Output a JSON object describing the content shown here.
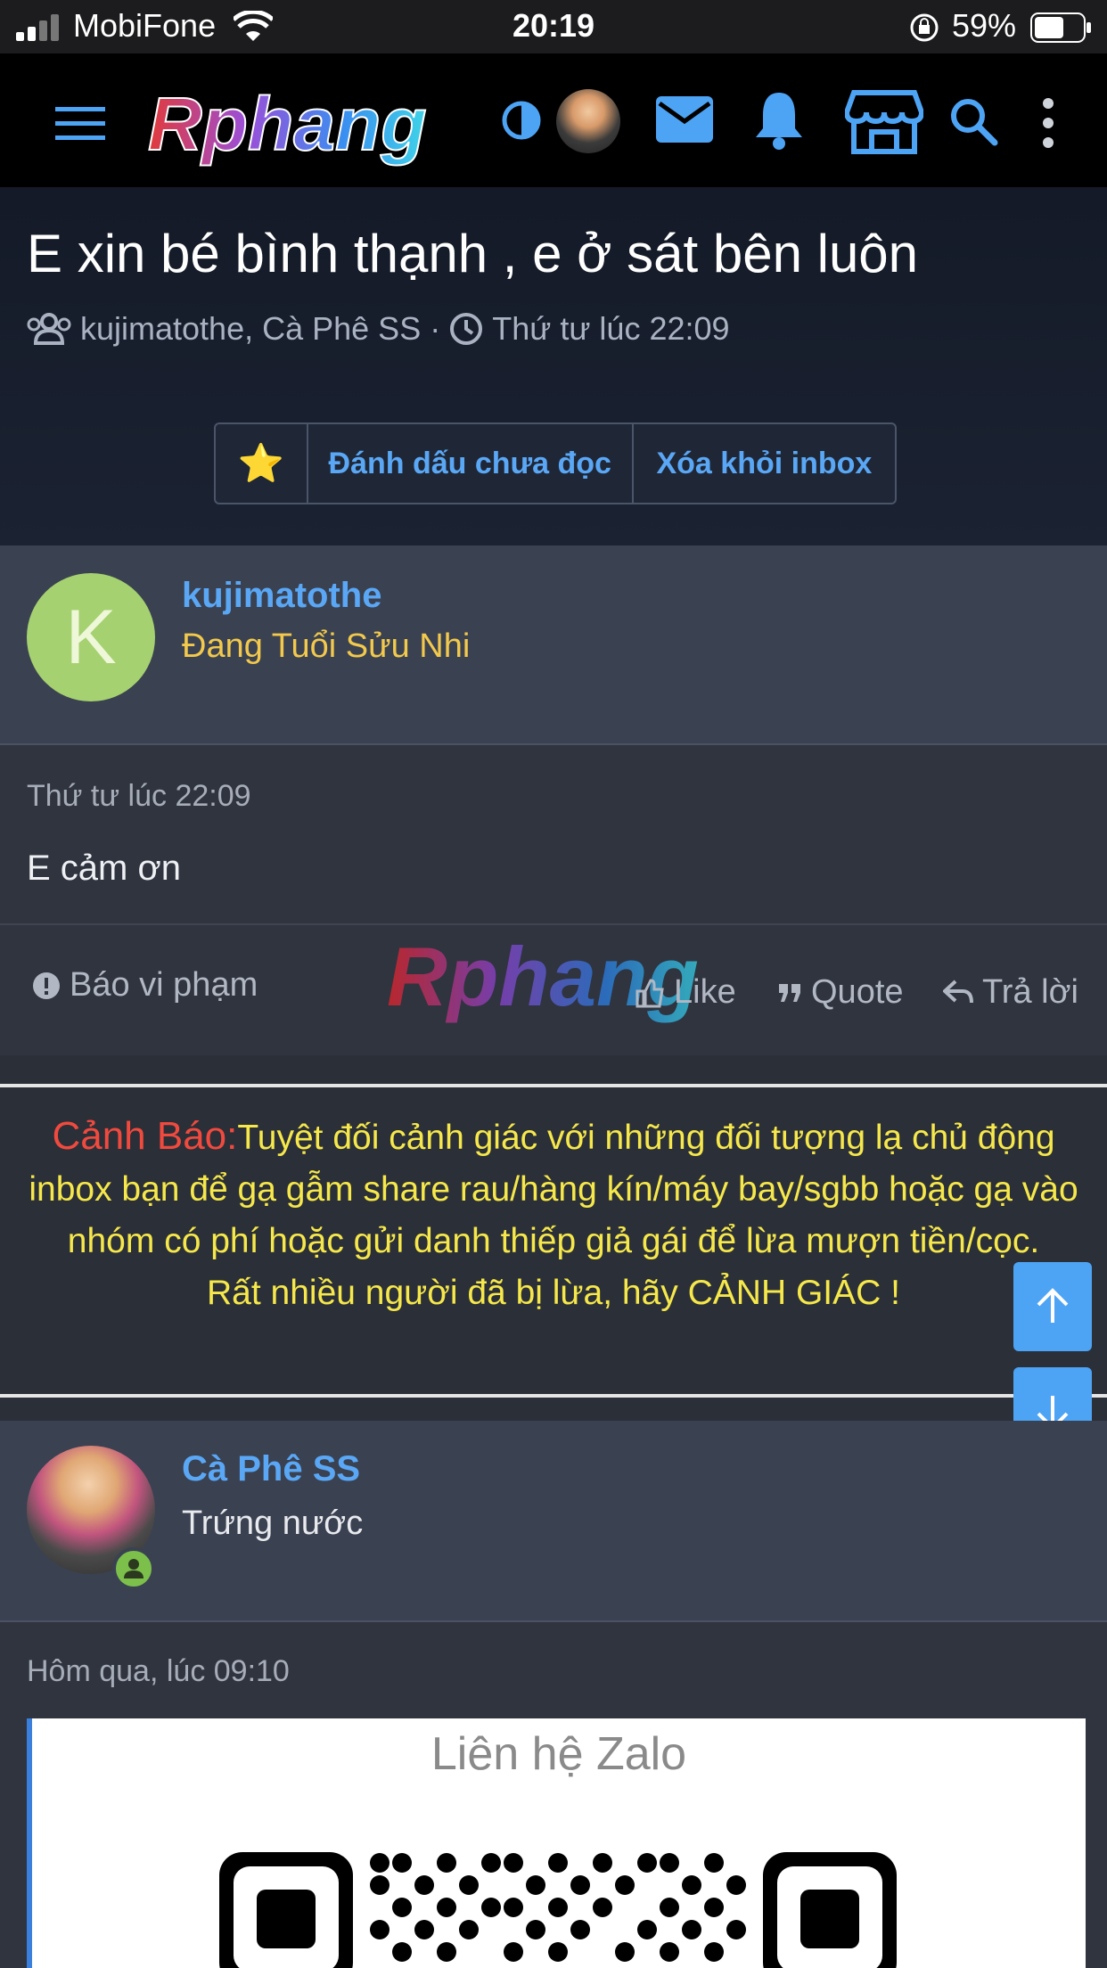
{
  "status_bar": {
    "carrier": "MobiFone",
    "time": "20:19",
    "battery": "59%"
  },
  "nav": {
    "logo": "Rphang",
    "icons": [
      "menu-icon",
      "contrast-icon",
      "avatar",
      "mail-icon",
      "bell-icon",
      "store-icon",
      "search-icon",
      "more-vertical-icon"
    ]
  },
  "thread": {
    "title": "E xin bé bình thạnh , e ở sát bên luôn",
    "participants": "kujimatothe, Cà Phê SS",
    "separator": "·",
    "date": "Thứ tư lúc 22:09",
    "buttons": {
      "star": "⭐",
      "mark_unread": "Đánh dấu chưa đọc",
      "remove_inbox": "Xóa khỏi inbox"
    }
  },
  "post1": {
    "avatar_letter": "K",
    "username": "kujimatothe",
    "user_title": "Đang Tuổi Sửu Nhi",
    "date": "Thứ tư lúc 22:09",
    "content": "E cảm ơn",
    "actions": {
      "report": "Báo vi phạm",
      "like": "Like",
      "quote": "Quote",
      "reply": "Trả lời"
    },
    "watermark": "Rphang"
  },
  "warning": {
    "label": "Cảnh Báo:",
    "text": "Tuyệt đối cảnh giác với những đối tượng lạ chủ động inbox bạn để gạ gẫm share rau/hàng kín/máy bay/sgbb hoặc gạ vào nhóm có phí hoặc gửi danh thiếp giả gái để lừa mượn tiền/cọc.",
    "text2": "Rất nhiều người đã bị lừa, hãy CẢNH GIÁC !"
  },
  "post2": {
    "username": "Cà Phê SS",
    "user_title": "Trứng nước",
    "date": "Hôm qua, lúc 09:10",
    "card_title": "Liên hệ Zalo"
  },
  "colors": {
    "accent": "#4da3f4",
    "gold": "#f2c94c",
    "warning_yellow": "#f6e84a",
    "warning_red": "#f04a3e"
  }
}
